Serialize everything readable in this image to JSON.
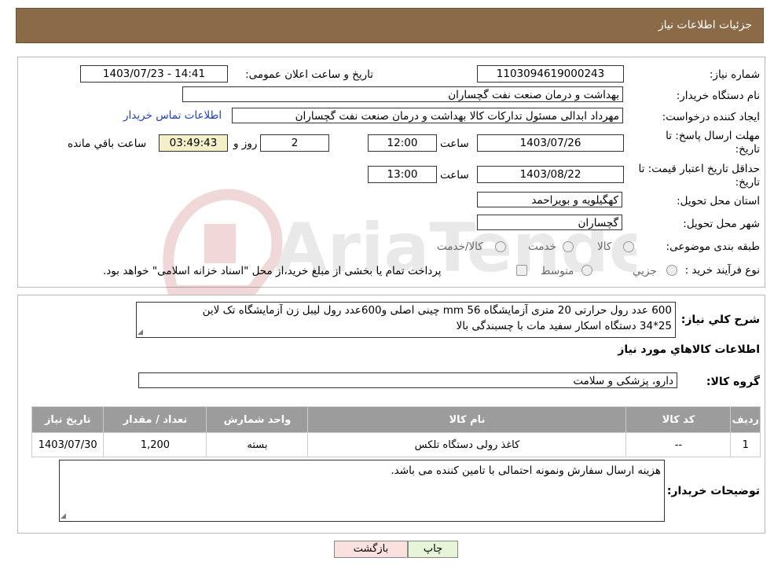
{
  "header": {
    "title": "جزئیات اطلاعات نیاز"
  },
  "form": {
    "need_number_label": "شماره نیاز:",
    "need_number": "1103094619000243",
    "announce_label": "تاریخ و ساعت اعلان عمومی:",
    "announce_value": "1403/07/23 - 14:41",
    "buyer_org_label": "نام دستگاه خریدار:",
    "buyer_org": "بهداشت و درمان صنعت نفت گچساران",
    "requester_label": "ایجاد کننده درخواست:",
    "requester": "مهرداد ابدالی مسئول تدارکات کالا  بهداشت و درمان صنعت نفت گچساران",
    "contact_link": "اطلاعات تماس خریدار",
    "deadline_label_1": "مهلت ارسال پاسخ: تا",
    "deadline_label_2": "تاریخ:",
    "deadline_date": "1403/07/26",
    "time_label": "ساعت",
    "deadline_time": "12:00",
    "days_value": "2",
    "days_label": "روز و",
    "remaining_time": "03:49:43",
    "remaining_label": "ساعت باقي مانده",
    "validity_label_1": "حداقل تاریخ اعتبار قیمت: تا",
    "validity_label_2": "تاریخ:",
    "validity_date": "1403/08/22",
    "validity_time": "13:00",
    "province_label": "استان محل تحویل:",
    "province": "کهگیلویه و بویراحمد",
    "city_label": "شهر محل تحویل:",
    "city": "گچساران",
    "category_label": "طبقه بندی موضوعی:",
    "category_options": [
      "کالا",
      "خدمت",
      "کالا/خدمت"
    ],
    "process_label": "نوع فرآیند خرید :",
    "process_options": [
      "جزیي",
      "متوسط"
    ],
    "process_note": "پرداخت تمام یا بخشی از مبلغ خرید،از محل \"اسناد خزانه اسلامی\" خواهد بود."
  },
  "description": {
    "label": "شرح کلي نیاز:",
    "line1": "600 عدد رول حرارتی 20 متری آزمایشگاه 56 mm چینی اصلی و600عدد رول لیبل زن آزمایشگاه تک لاین",
    "line2": "25*34 دستگاه اسکار سفید مات با چسبندگی بالا"
  },
  "goods": {
    "section_title": "اطلاعات کالاهاي مورد نیاز",
    "group_label": "گروه کالا:",
    "group_value": "دارو، پزشکی و سلامت",
    "columns": [
      "ردیف",
      "کد کالا",
      "نام کالا",
      "واحد شمارش",
      "تعداد / مقدار",
      "تاریخ نیاز"
    ],
    "rows": [
      [
        "1",
        "--",
        "کاغذ رولی دستگاه تلکس",
        "بسته",
        "1,200",
        "1403/07/30"
      ]
    ]
  },
  "buyer_notes": {
    "label": "توضیحات خریدار:",
    "text": "هزینه ارسال سفارش ونمونه احتمالی با تامین کننده می باشد."
  },
  "buttons": {
    "print": "چاپ",
    "back": "بازگشت"
  },
  "watermark_text": "AriaTender.neT"
}
